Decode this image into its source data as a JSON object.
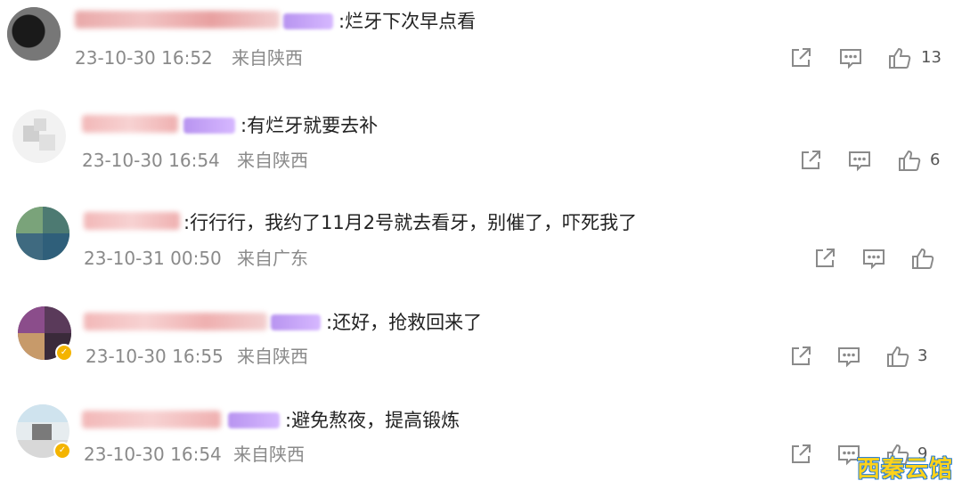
{
  "comments": [
    {
      "text": ":烂牙下次早点看",
      "timestamp": "23-10-30 16:52",
      "location": "来自陕西",
      "likes": "13",
      "verified": false
    },
    {
      "text": ":有烂牙就要去补",
      "timestamp": "23-10-30 16:54",
      "location": "来自陕西",
      "likes": "6",
      "verified": false
    },
    {
      "text": ":行行行，我约了11月2号就去看牙，别催了，吓死我了",
      "timestamp": "23-10-31 00:50",
      "location": "来自广东",
      "likes": "",
      "verified": false
    },
    {
      "text": ":还好，抢救回来了",
      "timestamp": "23-10-30 16:55",
      "location": "来自陕西",
      "likes": "3",
      "verified": true
    },
    {
      "text": ":避免熬夜，提高锻炼",
      "timestamp": "23-10-30 16:54",
      "location": "来自陕西",
      "likes": "9",
      "verified": true
    }
  ],
  "icons": {
    "share": "share-icon",
    "comment": "comment-icon",
    "like": "thumbs-up-icon"
  },
  "colors": {
    "text": "#222222",
    "meta": "#8a8a8a",
    "icon": "#8a8a8a",
    "badge": "#b894f0",
    "watermark": "#ffd21a"
  },
  "watermark": "西秦云馆"
}
